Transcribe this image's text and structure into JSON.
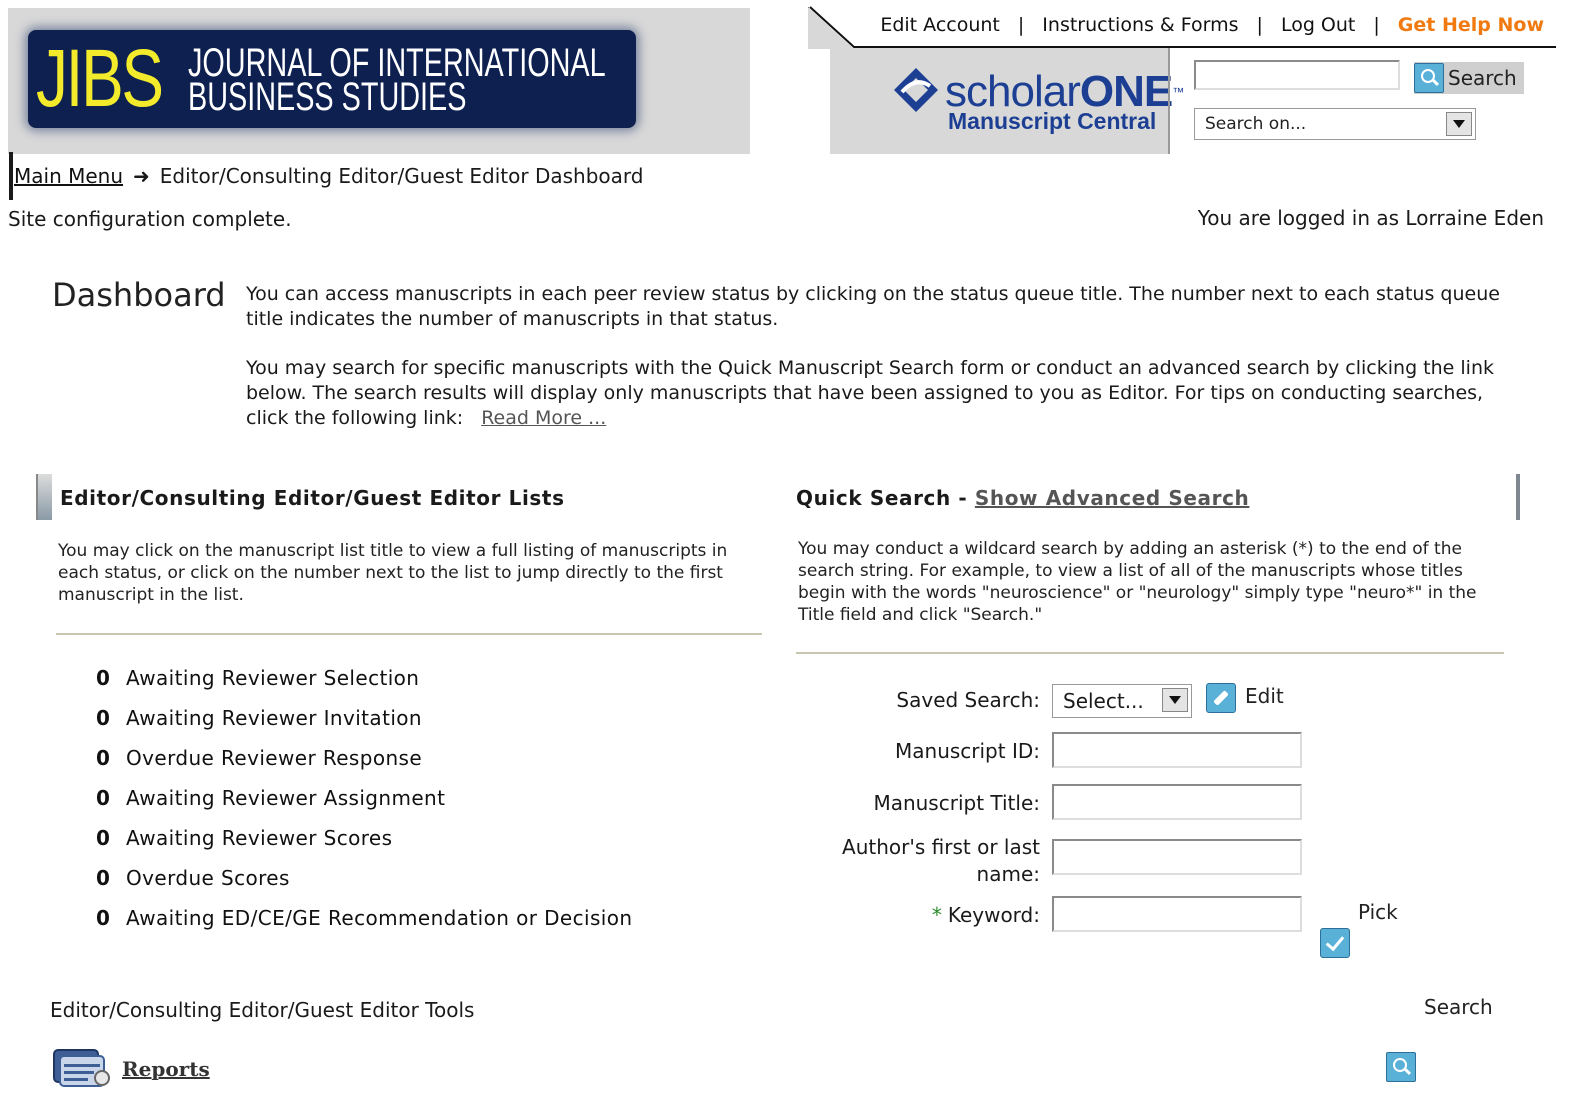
{
  "header": {
    "journal_abbr": "JIBS",
    "journal_name": "JOURNAL OF INTERNATIONAL\nBUSINESS STUDIES",
    "nav": {
      "edit_account": "Edit Account",
      "instructions": "Instructions & Forms",
      "logout": "Log Out",
      "help": "Get Help Now",
      "separator": "|"
    },
    "brand": {
      "word_light": "scholar",
      "word_bold": "ONE",
      "tm": "™",
      "sub": "Manuscript Central"
    },
    "search": {
      "value": "",
      "button": "Search",
      "select_value": "Search on..."
    }
  },
  "breadcrumb": {
    "home": "Main Menu",
    "arrow": "➜",
    "current": "Editor/Consulting Editor/Guest Editor Dashboard"
  },
  "status_message": "Site configuration complete.",
  "logged_in": "You are logged in as Lorraine Eden",
  "dashboard": {
    "title": "Dashboard",
    "intro_1": "You can access manuscripts in each peer review status by clicking on the status queue title. The number next to each status queue title indicates the number of manuscripts in that status.",
    "intro_2": "You may search for specific manuscripts with the Quick Manuscript Search form or conduct an advanced search by clicking the link below. The search results will display only manuscripts that have been assigned to you as Editor. For tips on conducting searches, click the following link:",
    "read_more": "Read More ..."
  },
  "lists": {
    "heading": "Editor/Consulting Editor/Guest Editor Lists",
    "description": "You may click on the manuscript list title to view a full listing of manuscripts in each status, or click on the number next to the list to jump directly to the first manuscript in the list.",
    "items": [
      {
        "count": "0",
        "label": "Awaiting Reviewer Selection"
      },
      {
        "count": "0",
        "label": "Awaiting Reviewer Invitation"
      },
      {
        "count": "0",
        "label": "Overdue Reviewer Response"
      },
      {
        "count": "0",
        "label": "Awaiting Reviewer Assignment"
      },
      {
        "count": "0",
        "label": "Awaiting Reviewer Scores"
      },
      {
        "count": "0",
        "label": "Overdue Scores"
      },
      {
        "count": "0",
        "label": "Awaiting ED/CE/GE Recommendation or Decision"
      }
    ]
  },
  "quick_search": {
    "heading": "Quick Search",
    "dash": " - ",
    "advanced_link": "Show Advanced Search",
    "description": "You may conduct a wildcard search by adding an asterisk (*) to the end of the search string. For example, to view a list of all of the manuscripts whose titles begin with the words \"neuroscience\" or \"neurology\" simply type \"neuro*\" in the Title field and click \"Search.\"",
    "saved_search_label": "Saved Search:",
    "saved_search_value": "Select...",
    "edit_label": "Edit",
    "manuscript_id_label": "Manuscript ID:",
    "manuscript_title_label": "Manuscript Title:",
    "author_label_1": "Author's first or last",
    "author_label_2": "name:",
    "keyword_star": "*",
    "keyword_label": "Keyword:",
    "pick_label": "Pick",
    "search_button": "Search",
    "values": {
      "manuscript_id": "",
      "manuscript_title": "",
      "author": "",
      "keyword": ""
    }
  },
  "tools": {
    "heading": "Editor/Consulting Editor/Guest Editor Tools",
    "reports": "Reports"
  }
}
